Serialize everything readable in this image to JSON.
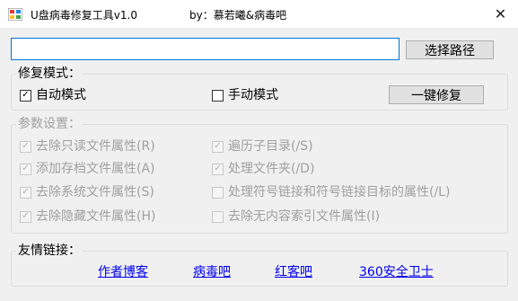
{
  "window": {
    "title": "U盘病毒修复工具v1.0",
    "byline": "by：慕若曦&病毒吧",
    "close_glyph": "✕"
  },
  "path_field": {
    "value": "",
    "placeholder": ""
  },
  "browse_button": "选择路径",
  "mode_group": {
    "legend": "修复模式：",
    "auto": {
      "label": "自动模式",
      "checked": true
    },
    "manual": {
      "label": "手动模式",
      "checked": false
    },
    "repair_button": "一键修复"
  },
  "params_group": {
    "legend": "参数设置：",
    "options": [
      {
        "label": "去除只读文件属性(R)",
        "checked": true
      },
      {
        "label": "遍历子目录(/S)",
        "checked": true
      },
      {
        "label": "添加存档文件属性(A)",
        "checked": true
      },
      {
        "label": "处理文件夹(/D)",
        "checked": true
      },
      {
        "label": "去除系统文件属性(S)",
        "checked": true
      },
      {
        "label": "处理符号链接和符号链接目标的属性(/L)",
        "checked": false
      },
      {
        "label": "去除隐藏文件属性(H)",
        "checked": true
      },
      {
        "label": "去除无内容索引文件属性(I)",
        "checked": false
      }
    ]
  },
  "links_group": {
    "legend": "友情链接：",
    "links": [
      "作者博客",
      "病毒吧",
      "红客吧",
      "360安全卫士"
    ]
  },
  "colors": {
    "link": "#0000ee",
    "focus_border": "#0078d7",
    "disabled_text": "#a0a0a0"
  },
  "icons": {
    "app": "app-icon",
    "close": "close-icon",
    "check": "checkmark-icon"
  }
}
